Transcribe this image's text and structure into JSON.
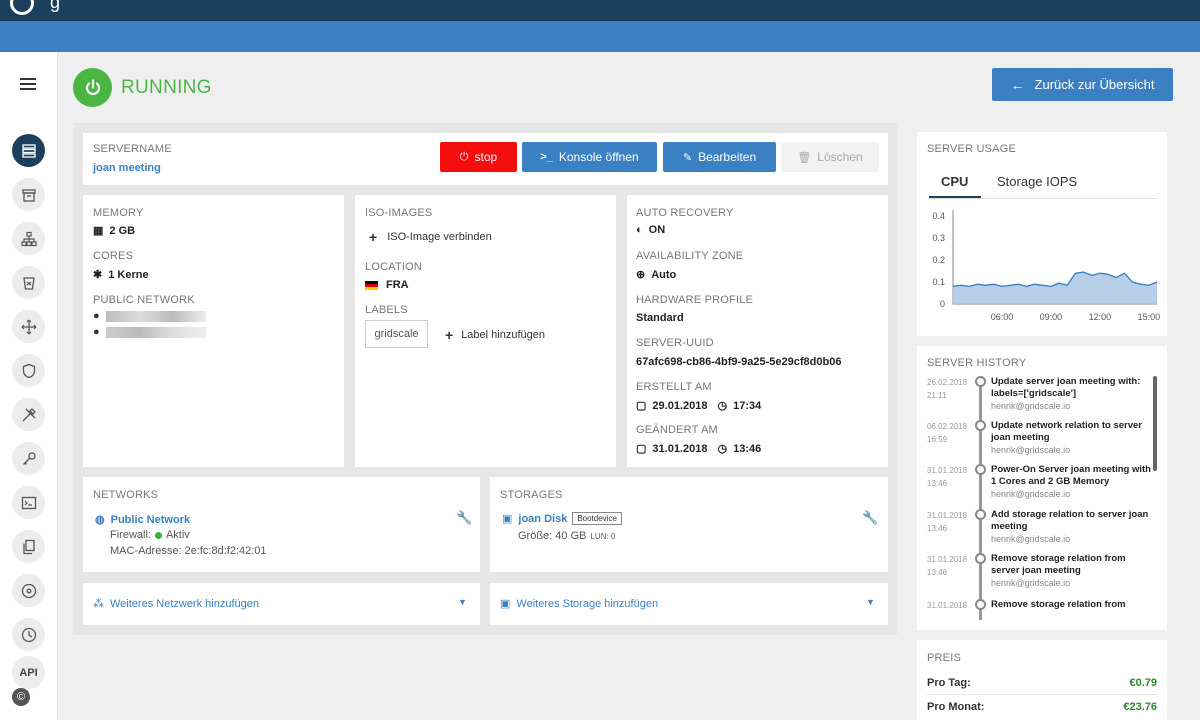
{
  "app": {
    "logo_letter": "g"
  },
  "status": {
    "text": "RUNNING"
  },
  "header": {
    "back_label": "Zurück zur Übersicht"
  },
  "server": {
    "name_label": "SERVERNAME",
    "name": "joan meeting",
    "buttons": {
      "stop": "stop",
      "console": "Konsole öffnen",
      "edit": "Bearbeiten",
      "delete": "Löschen"
    }
  },
  "specs": {
    "memory_label": "MEMORY",
    "memory": "2 GB",
    "cores_label": "CORES",
    "cores": "1 Kerne",
    "public_network_label": "PUBLIC NETWORK"
  },
  "iso": {
    "label": "ISO-IMAGES",
    "connect": "ISO-Image verbinden",
    "location_label": "LOCATION",
    "location": "FRA",
    "labels_label": "LABELS",
    "tag": "gridscale",
    "add_label": "Label hinzufügen"
  },
  "meta": {
    "auto_recovery_label": "AUTO RECOVERY",
    "auto_recovery": "ON",
    "zone_label": "AVAILABILITY ZONE",
    "zone": "Auto",
    "hw_label": "HARDWARE PROFILE",
    "hw": "Standard",
    "uuid_label": "SERVER-UUID",
    "uuid": "67afc698-cb86-4bf9-9a25-5e29cf8d0b06",
    "created_label": "ERSTELLT AM",
    "created_date": "29.01.2018",
    "created_time": "17:34",
    "changed_label": "GEÄNDERT AM",
    "changed_date": "31.01.2018",
    "changed_time": "13:46"
  },
  "networks": {
    "label": "NETWORKS",
    "name": "Public Network",
    "firewall_label": "Firewall:",
    "firewall_status": "Aktiv",
    "mac": "MAC-Adresse: 2e:fc:8d:f2:42:01",
    "add": "Weiteres Netzwerk hinzufügen"
  },
  "storages": {
    "label": "STORAGES",
    "name": "joan Disk",
    "badge": "Bootdevice",
    "size": "Größe: 40 GB",
    "lun": "LUN: 0",
    "add": "Weiteres Storage hinzufügen"
  },
  "usage": {
    "label": "SERVER USAGE",
    "tabs": [
      "CPU",
      "Storage IOPS"
    ],
    "colors": {
      "line": "#3a80c3",
      "fill": "#a9c6e3"
    }
  },
  "chart_data": {
    "type": "area",
    "title": "",
    "x_ticks": [
      "06:00",
      "09:00",
      "12:00",
      "15:00"
    ],
    "y_ticks": [
      "0.4",
      "0.3",
      "0.2",
      "0.1",
      "0"
    ],
    "ylim": [
      0,
      0.4
    ],
    "x": [
      "03:00",
      "03:30",
      "04:00",
      "04:30",
      "05:00",
      "05:30",
      "06:00",
      "06:30",
      "07:00",
      "07:30",
      "08:00",
      "08:30",
      "09:00",
      "09:30",
      "10:00",
      "10:30",
      "11:00",
      "11:30",
      "12:00",
      "12:30",
      "13:00",
      "13:30",
      "14:00",
      "14:30",
      "15:00",
      "15:30"
    ],
    "values": [
      0.08,
      0.085,
      0.08,
      0.09,
      0.085,
      0.09,
      0.08,
      0.085,
      0.09,
      0.08,
      0.09,
      0.085,
      0.08,
      0.095,
      0.085,
      0.14,
      0.145,
      0.13,
      0.14,
      0.135,
      0.12,
      0.14,
      0.1,
      0.09,
      0.085,
      0.1
    ]
  },
  "history": {
    "label": "SERVER HISTORY",
    "items": [
      {
        "date": "26.02.2018",
        "time": "21:11",
        "title": "Update server joan meeting with: labels=['gridscale']",
        "user": "henrik@gridscale.io"
      },
      {
        "date": "06.02.2018",
        "time": "16:59",
        "title": "Update network relation to server joan meeting",
        "user": "henrik@gridscale.io"
      },
      {
        "date": "31.01.2018",
        "time": "13:46",
        "title": "Power-On Server joan meeting with 1 Cores and 2 GB Memory",
        "user": "henrik@gridscale.io"
      },
      {
        "date": "31.01.2018",
        "time": "13:46",
        "title": "Add storage relation to server joan meeting",
        "user": "henrik@gridscale.io"
      },
      {
        "date": "31.01.2018",
        "time": "13:46",
        "title": "Remove storage relation from server joan meeting",
        "user": "henrik@gridscale.io"
      },
      {
        "date": "31.01.2018",
        "time": "",
        "title": "Remove storage relation from",
        "user": ""
      }
    ]
  },
  "price": {
    "label": "PREIS",
    "day_label": "Pro Tag:",
    "day": "€0.79",
    "month_label": "Pro Monat:",
    "month": "€23.76"
  },
  "sidebar": {
    "api_label": "API"
  }
}
